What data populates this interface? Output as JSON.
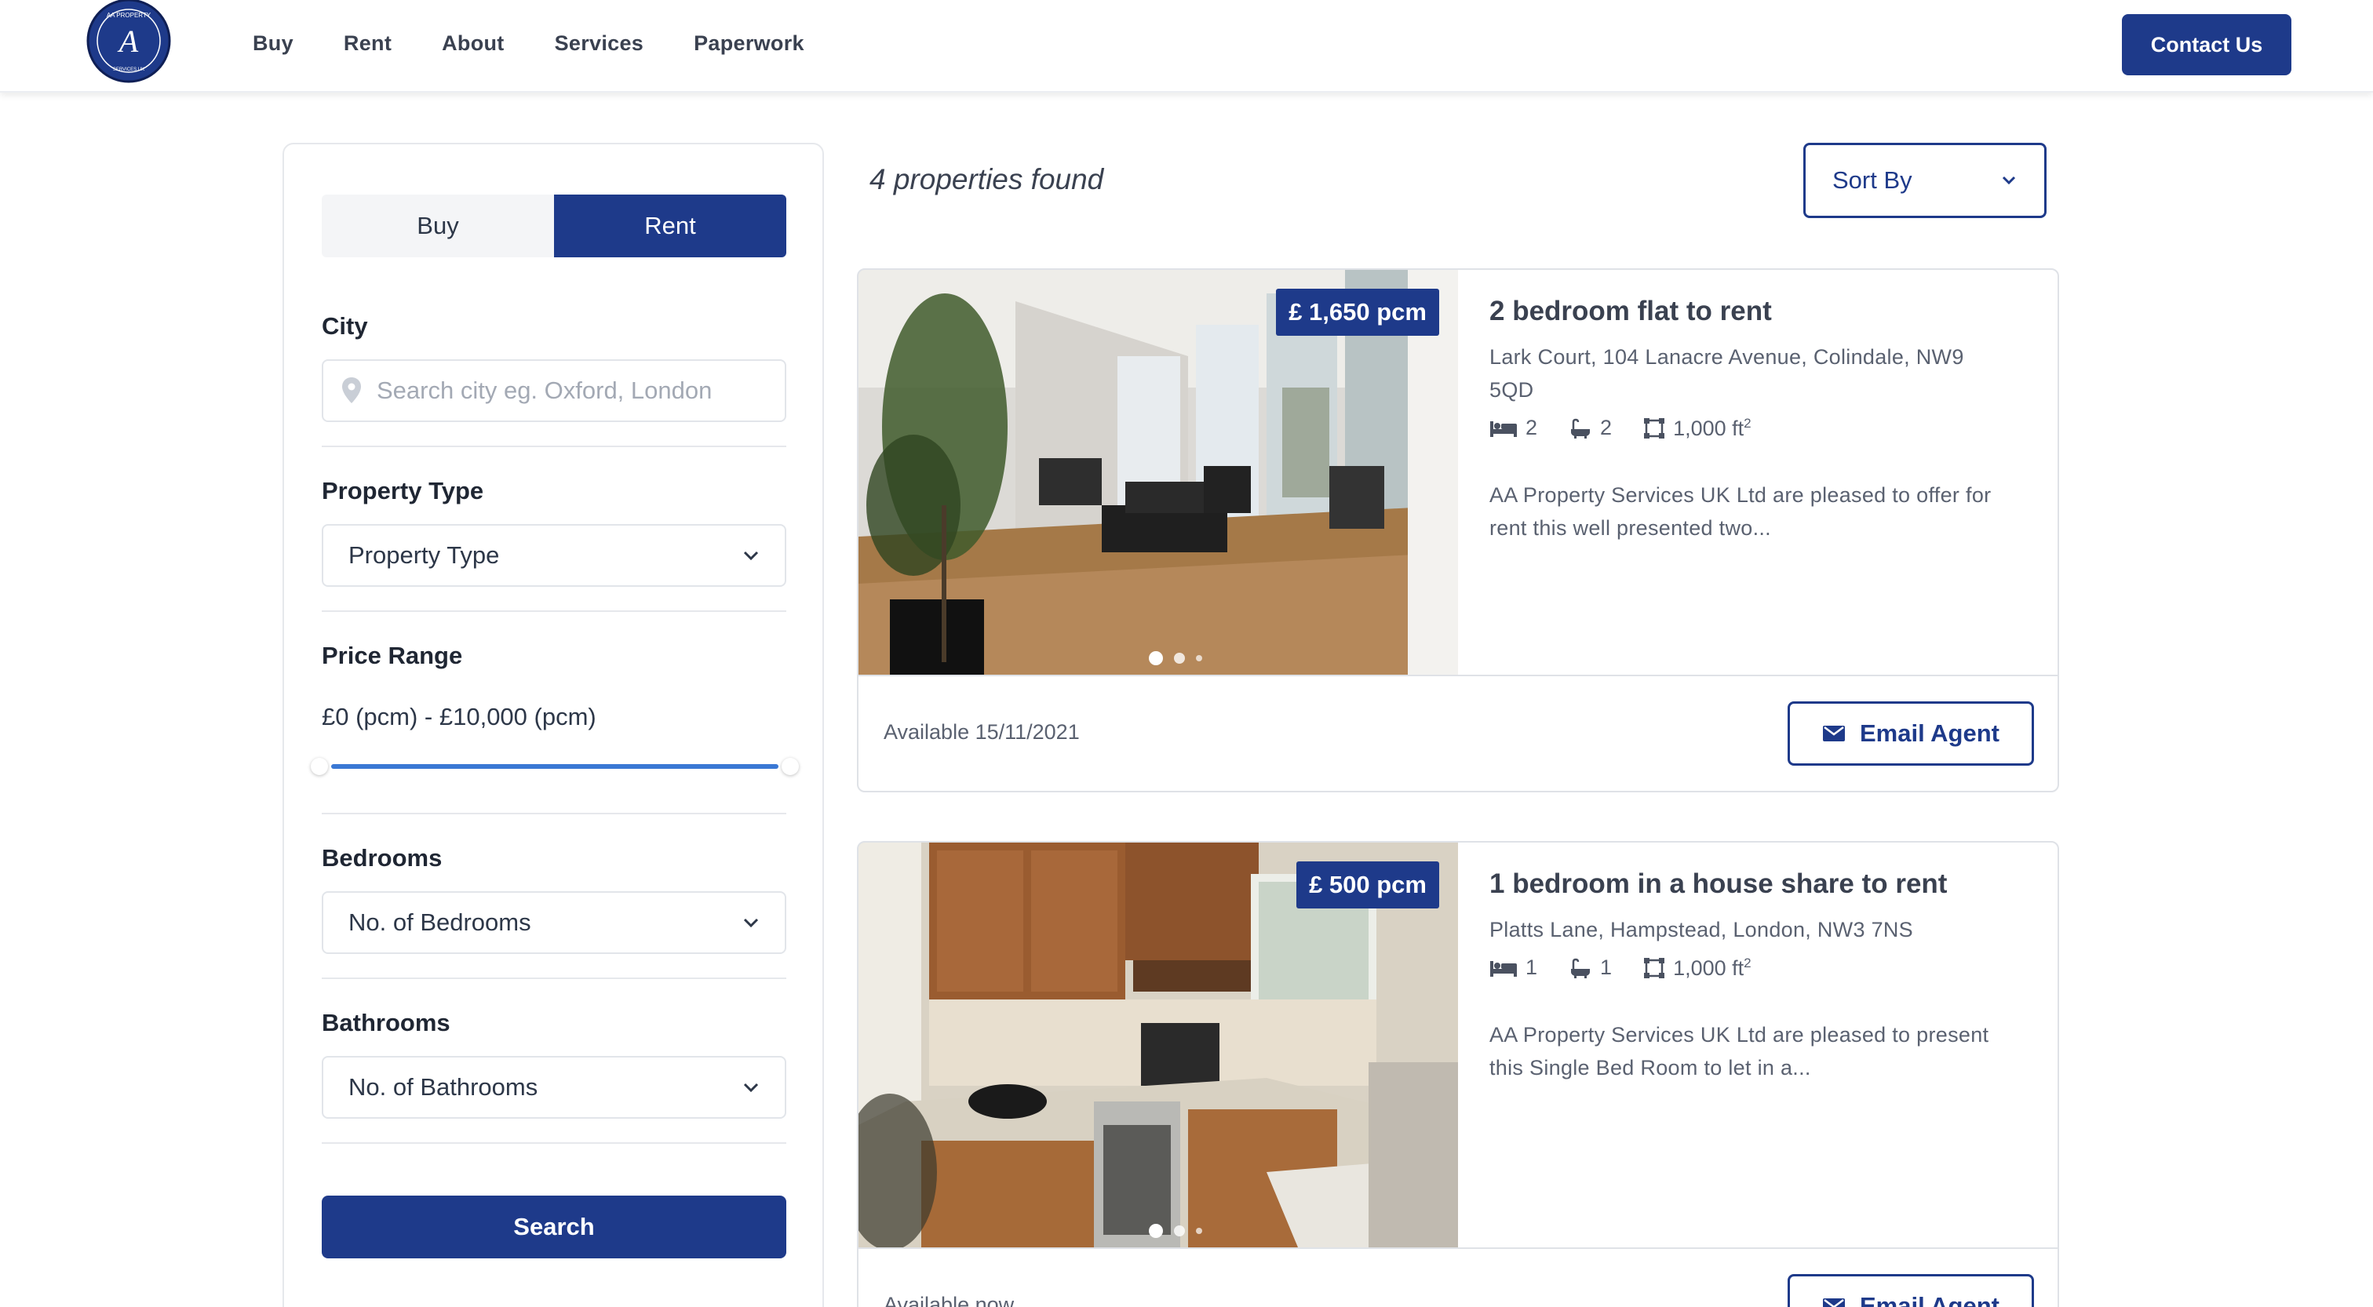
{
  "header": {
    "logo_text": "AA PROPERTY SERVICES UK · CONFIDENTIALITY GUARANTEED",
    "nav": [
      "Buy",
      "Rent",
      "About",
      "Services",
      "Paperwork"
    ],
    "contact_label": "Contact Us"
  },
  "filters": {
    "toggle": {
      "buy": "Buy",
      "rent": "Rent",
      "active": "Rent"
    },
    "city": {
      "label": "City",
      "placeholder": "Search city eg. Oxford, London"
    },
    "property_type": {
      "label": "Property Type",
      "value": "Property Type"
    },
    "price_range": {
      "label": "Price Range",
      "text": "£0 (pcm) - £10,000 (pcm)",
      "min": 0,
      "max": 10000
    },
    "bedrooms": {
      "label": "Bedrooms",
      "value": "No. of Bedrooms"
    },
    "bathrooms": {
      "label": "Bathrooms",
      "value": "No. of Bathrooms"
    },
    "search_label": "Search"
  },
  "results": {
    "count_text": "4 properties found",
    "sort_label": "Sort By",
    "email_label": "Email Agent",
    "listings": [
      {
        "price": "£ 1,650 pcm",
        "title": "2 bedroom flat to rent",
        "address": "Lark Court, 104 Lanacre Avenue, Colindale, NW9 5QD",
        "beds": "2",
        "baths": "2",
        "area": "1,000 ft",
        "area_unit_sup": "2",
        "description": "AA Property Services UK Ltd are pleased to offer for rent this well presented two...",
        "availability": "Available 15/11/2021"
      },
      {
        "price": "£ 500 pcm",
        "title": "1 bedroom in a house share to rent",
        "address": "Platts Lane, Hampstead, London, NW3 7NS",
        "beds": "1",
        "baths": "1",
        "area": "1,000 ft",
        "area_unit_sup": "2",
        "description": "AA Property Services UK Ltd are pleased to present this Single Bed Room to let in a...",
        "availability": "Available now"
      }
    ]
  },
  "colors": {
    "brand": "#1e3a8a",
    "slider": "#3a78d4"
  }
}
